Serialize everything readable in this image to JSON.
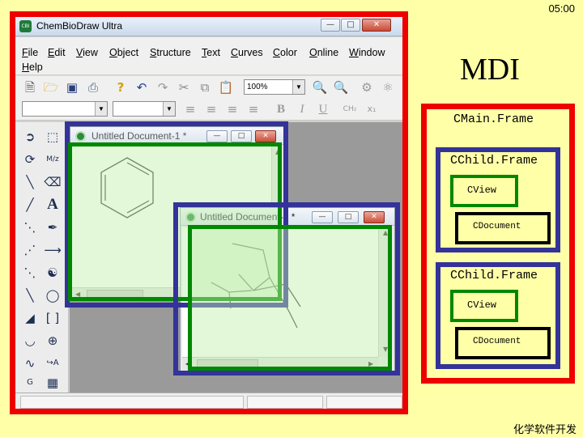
{
  "clock": "05:00",
  "footer": "化学软件开发",
  "app": {
    "title": "ChemBioDraw Ultra",
    "icon_text": "CBI",
    "menus": [
      "File",
      "Edit",
      "View",
      "Object",
      "Structure",
      "Text",
      "Curves",
      "Color",
      "Online",
      "Window",
      "Help"
    ],
    "zoom": "100%",
    "font_combo": "",
    "size_combo": ""
  },
  "documents": [
    {
      "title": "Untitled Document-1 *",
      "content": "benzene-ring"
    },
    {
      "title": "Untitled Document-2 *",
      "content": "drawn-structure"
    }
  ],
  "diagram": {
    "title": "MDI",
    "main_frame": "CMain.Frame",
    "children": [
      {
        "frame": "CChild.Frame",
        "view": "CView",
        "document": "CDocument"
      },
      {
        "frame": "CChild.Frame",
        "view": "CView",
        "document": "CDocument"
      }
    ]
  },
  "colors": {
    "background": "#ffffa8",
    "main_frame_border": "#ee0000",
    "child_frame_border": "#333399",
    "view_border": "#008800",
    "document_border": "#000000"
  },
  "icons": {
    "new": "new-file-icon",
    "open": "open-folder-icon",
    "save": "save-icon",
    "print": "print-icon",
    "help": "help-icon",
    "undo": "undo-icon",
    "redo": "redo-icon",
    "cut": "cut-icon",
    "copy": "copy-icon",
    "paste": "paste-icon",
    "zoom_in": "zoom-in-icon",
    "zoom_out": "zoom-out-icon"
  }
}
